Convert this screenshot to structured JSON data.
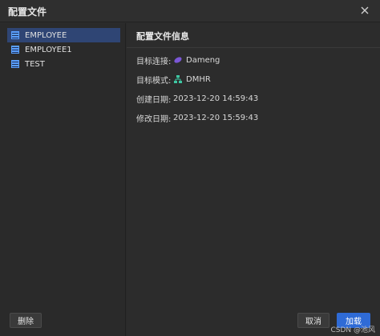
{
  "dialog": {
    "title": "配置文件"
  },
  "sidebar": {
    "items": [
      {
        "label": "EMPLOYEE",
        "selected": true
      },
      {
        "label": "EMPLOYEE1",
        "selected": false
      },
      {
        "label": "TEST",
        "selected": false
      }
    ]
  },
  "details": {
    "title": "配置文件信息",
    "fields": [
      {
        "label": "目标连接:",
        "value": "Dameng",
        "icon": "database-oval-icon"
      },
      {
        "label": "目标模式:",
        "value": "DMHR",
        "icon": "schema-tree-icon"
      },
      {
        "label": "创建日期:",
        "value": "2023-12-20 14:59:43"
      },
      {
        "label": "修改日期:",
        "value": "2023-12-20 15:59:43"
      }
    ]
  },
  "footer": {
    "delete_label": "删除",
    "cancel_label": "取消",
    "load_label": "加载"
  },
  "watermark": "CSDN @池风",
  "colors": {
    "selected_bg": "#2f4574",
    "primary": "#2f6bd6",
    "dameng_icon": "#7b57d6",
    "schema_icon": "#3ec7a3"
  }
}
